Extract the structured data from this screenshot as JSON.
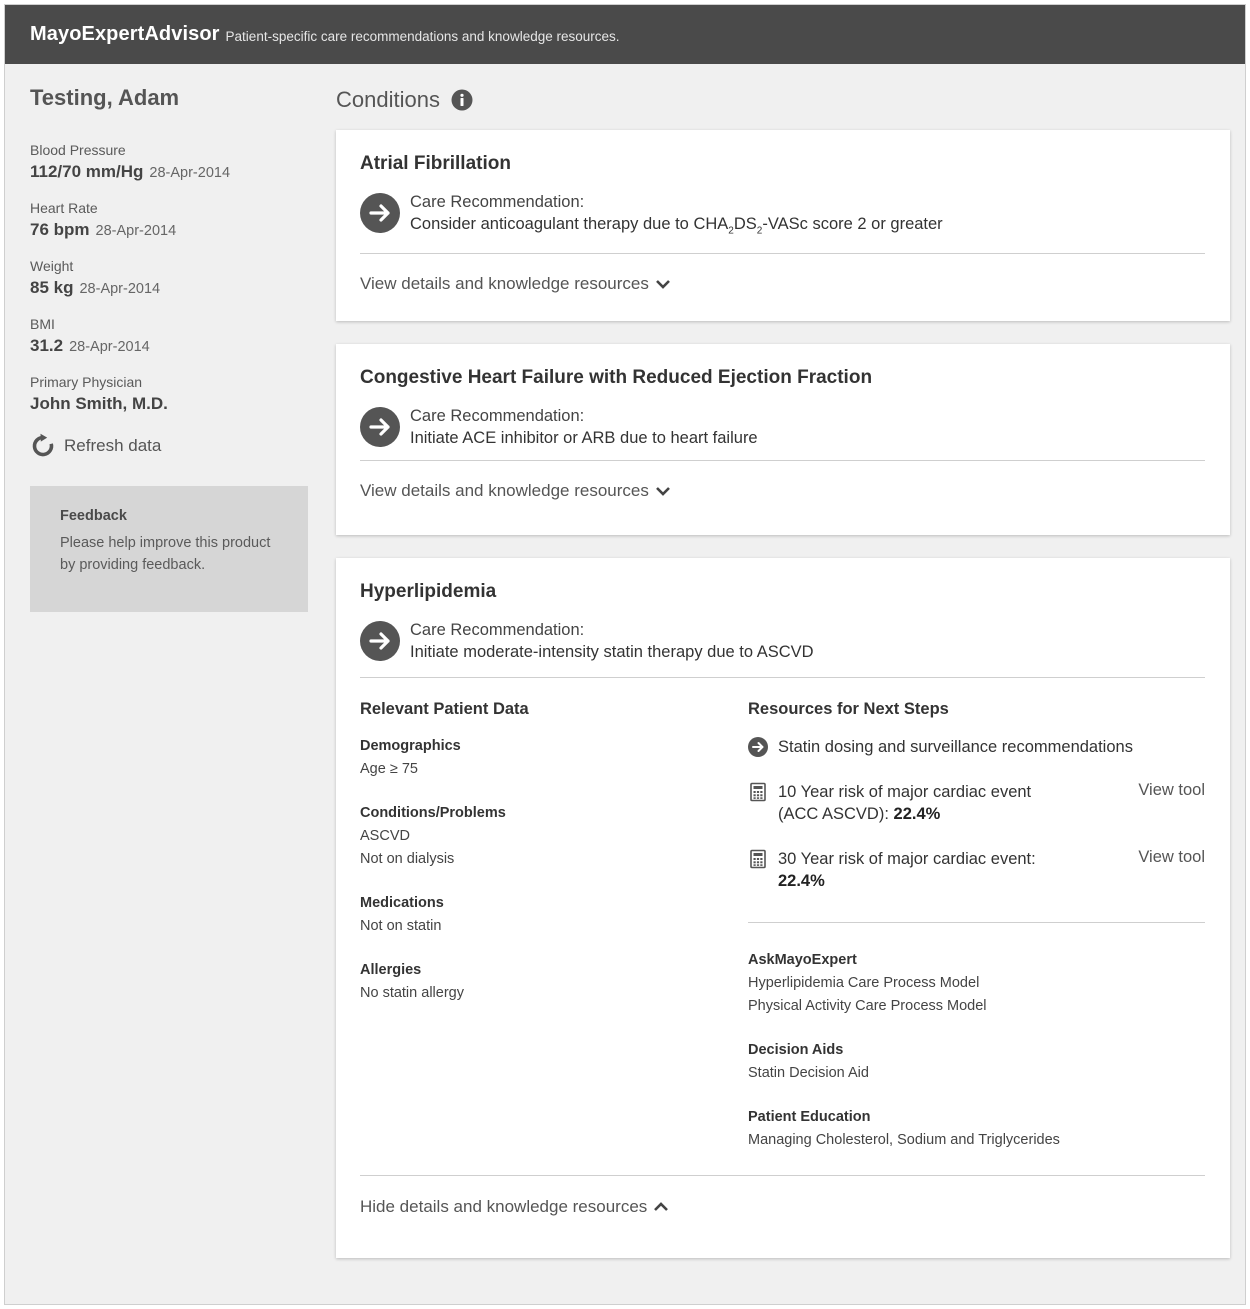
{
  "header": {
    "brand": "MayoExpertAdvisor",
    "tagline": "Patient-specific care recommendations and knowledge resources."
  },
  "patient": {
    "name": "Testing, Adam",
    "vitals": [
      {
        "label": "Blood Pressure",
        "value": "112/70 mm/Hg",
        "date": "28-Apr-2014"
      },
      {
        "label": "Heart Rate",
        "value": "76 bpm",
        "date": "28-Apr-2014"
      },
      {
        "label": "Weight",
        "value": "85 kg",
        "date": "28-Apr-2014"
      },
      {
        "label": "BMI",
        "value": "31.2",
        "date": "28-Apr-2014"
      },
      {
        "label": "Primary Physician",
        "value": "John Smith, M.D.",
        "date": ""
      }
    ],
    "refresh_label": "Refresh data"
  },
  "feedback": {
    "title": "Feedback",
    "text": "Please help improve this product by providing feedback."
  },
  "conditions_title": "Conditions",
  "rec_label": "Care Recommendation:",
  "view_details_label": "View details and knowledge resources",
  "hide_details_label": "Hide details and knowledge resources",
  "conditions": [
    {
      "title": "Atrial Fibrillation",
      "rec_parts": [
        "Consider anticoagulant therapy due to CHA",
        "2",
        "DS",
        "2",
        "-VASc score 2 or greater"
      ]
    },
    {
      "title": "Congestive Heart Failure with Reduced Ejection Fraction",
      "rec": "Initiate ACE inhibitor or ARB due to heart failure"
    },
    {
      "title": "Hyperlipidemia",
      "rec": "Initiate moderate-intensity statin therapy due to ASCVD"
    }
  ],
  "patient_data": {
    "heading": "Relevant Patient Data",
    "groups": [
      {
        "title": "Demographics",
        "lines": [
          "Age ≥ 75"
        ]
      },
      {
        "title": "Conditions/Problems",
        "lines": [
          "ASCVD",
          "Not on dialysis"
        ]
      },
      {
        "title": "Medications",
        "lines": [
          "Not on statin"
        ]
      },
      {
        "title": "Allergies",
        "lines": [
          "No statin allergy"
        ]
      }
    ]
  },
  "resources": {
    "heading": "Resources for Next Steps",
    "statin_link": "Statin dosing and surveillance recommendations",
    "risk_tools": [
      {
        "text": "10 Year risk of major cardiac event (ACC ASCVD):",
        "value": "22.4%",
        "action": "View tool"
      },
      {
        "text": "30 Year risk of major cardiac event:",
        "value": "22.4%",
        "action": "View tool"
      }
    ],
    "groups": [
      {
        "title": "AskMayoExpert",
        "lines": [
          "Hyperlipidemia Care Process Model",
          "Physical Activity Care Process Model"
        ]
      },
      {
        "title": "Decision Aids",
        "lines": [
          "Statin Decision Aid"
        ]
      },
      {
        "title": "Patient Education",
        "lines": [
          "Managing Cholesterol, Sodium and Triglycerides"
        ]
      }
    ]
  },
  "colors": {
    "header_bg": "#4a4a4a",
    "page_bg": "#f0f0f0",
    "icon_dark": "#555555",
    "feedback_bg": "#d6d6d6"
  }
}
